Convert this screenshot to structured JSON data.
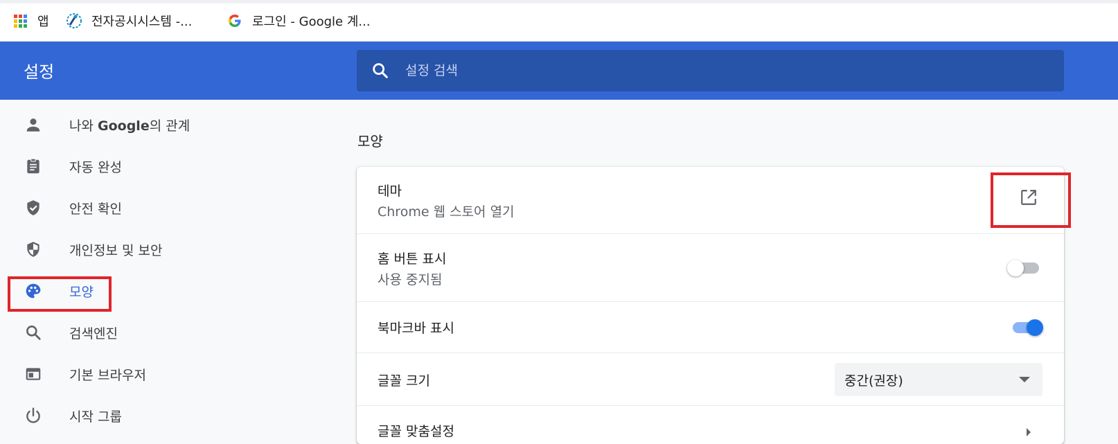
{
  "bookmarks": {
    "apps_label": "앱",
    "items": [
      {
        "label": "전자공시시스템 -..."
      },
      {
        "label": "로그인 - Google 계..."
      }
    ]
  },
  "header": {
    "title": "설정",
    "search_placeholder": "설정 검색"
  },
  "sidebar": {
    "items": [
      {
        "label_pre": "나와 ",
        "label_brand": "Google",
        "label_post": "의 관계",
        "icon": "person-icon"
      },
      {
        "label": "자동 완성",
        "icon": "clipboard-icon"
      },
      {
        "label": "안전 확인",
        "icon": "shield-check-icon"
      },
      {
        "label": "개인정보 및 보안",
        "icon": "shield-half-icon"
      },
      {
        "label": "모양",
        "icon": "palette-icon",
        "active": true
      },
      {
        "label": "검색엔진",
        "icon": "search-icon"
      },
      {
        "label": "기본 브라우저",
        "icon": "browser-window-icon"
      },
      {
        "label": "시작 그룹",
        "icon": "power-icon"
      }
    ]
  },
  "main": {
    "section_title": "모양",
    "rows": {
      "theme": {
        "title": "테마",
        "subtitle": "Chrome 웹 스토어 열기"
      },
      "home_button": {
        "title": "홈 버튼 표시",
        "subtitle": "사용 중지됨",
        "enabled": false
      },
      "bookmarks_bar": {
        "title": "북마크바 표시",
        "enabled": true
      },
      "font_size": {
        "title": "글꼴 크기",
        "value": "중간(권장)"
      },
      "custom_fonts": {
        "title": "글꼴 맞춤설정"
      }
    }
  },
  "colors": {
    "accent": "#3367d6",
    "header_bg": "#3367d6",
    "search_bg": "#2753a9",
    "highlight_red": "#e0242a",
    "toggle_on": "#1a73e8",
    "toggle_on_track": "#8ab4f8"
  }
}
